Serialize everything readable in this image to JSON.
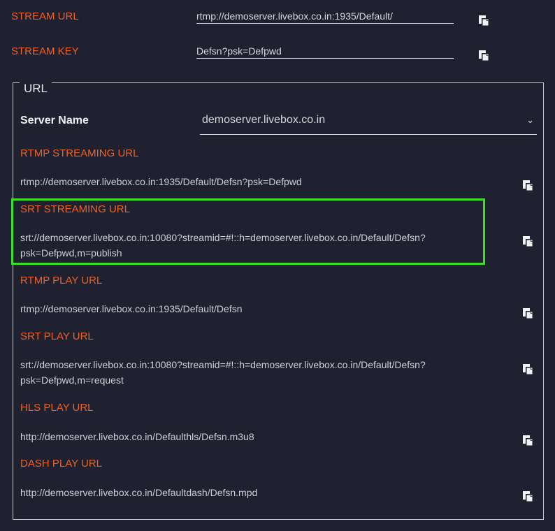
{
  "stream": {
    "url_label": "STREAM URL",
    "url_value": "rtmp://demoserver.livebox.co.in:1935/Default/",
    "key_label": "STREAM KEY",
    "key_value": "Defsn?psk=Defpwd"
  },
  "url_section": {
    "legend": "URL",
    "server_label": "Server Name",
    "server_value": "demoserver.livebox.co.in",
    "items": [
      {
        "label": "RTMP STREAMING URL",
        "value": "rtmp://demoserver.livebox.co.in:1935/Default/Defsn?psk=Defpwd"
      },
      {
        "label": "SRT STREAMING URL",
        "value": "srt://demoserver.livebox.co.in:10080?streamid=#!::h=demoserver.livebox.co.in/Default/Defsn?psk=Defpwd,m=publish"
      },
      {
        "label": "RTMP PLAY URL",
        "value": "rtmp://demoserver.livebox.co.in:1935/Default/Defsn"
      },
      {
        "label": "SRT PLAY URL",
        "value": "srt://demoserver.livebox.co.in:10080?streamid=#!::h=demoserver.livebox.co.in/Default/Defsn?psk=Defpwd,m=request"
      },
      {
        "label": "HLS PLAY URL",
        "value": "http://demoserver.livebox.co.in/Defaulthls/Defsn.m3u8"
      },
      {
        "label": "DASH PLAY URL",
        "value": "http://demoserver.livebox.co.in/Defaultdash/Defsn.mpd"
      }
    ]
  },
  "icons": {
    "copy": "copy-icon",
    "dropdown": "chevron-down-icon"
  },
  "colors": {
    "background": "#1f2130",
    "accent": "#e8632b",
    "highlight": "#3be02b"
  }
}
